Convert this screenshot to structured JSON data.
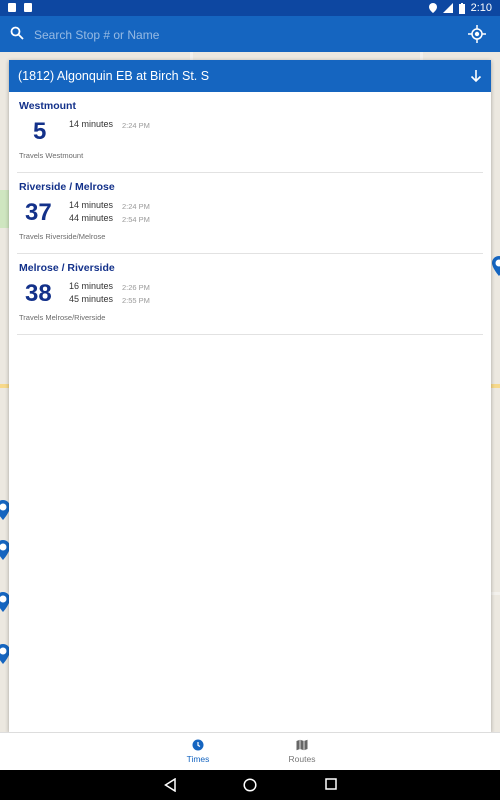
{
  "status_bar": {
    "time": "2:10"
  },
  "search": {
    "placeholder": "Search Stop # or Name"
  },
  "stop": {
    "title": "(1812) Algonquin EB at Birch St. S"
  },
  "routes": [
    {
      "name": "Westmount",
      "number": "5",
      "arrivals": [
        {
          "minutes": "14 minutes",
          "time": "2:24 PM"
        }
      ],
      "description": "Travels Westmount"
    },
    {
      "name": "Riverside / Melrose",
      "number": "37",
      "arrivals": [
        {
          "minutes": "14 minutes",
          "time": "2:24 PM"
        },
        {
          "minutes": "44 minutes",
          "time": "2:54 PM"
        }
      ],
      "description": "Travels Riverside/Melrose"
    },
    {
      "name": "Melrose / Riverside",
      "number": "38",
      "arrivals": [
        {
          "minutes": "16 minutes",
          "time": "2:26 PM"
        },
        {
          "minutes": "45 minutes",
          "time": "2:55 PM"
        }
      ],
      "description": "Travels Melrose/Riverside"
    }
  ],
  "bottom_nav": {
    "times": "Times",
    "routes": "Routes"
  },
  "colors": {
    "primary": "#1565c0",
    "dark": "#0d47a1",
    "route_text": "#13318a"
  },
  "icons": [
    "search-icon",
    "my-location-icon",
    "collapse-arrow-icon",
    "clock-icon",
    "map-icon",
    "back-icon",
    "home-icon",
    "recents-icon"
  ]
}
